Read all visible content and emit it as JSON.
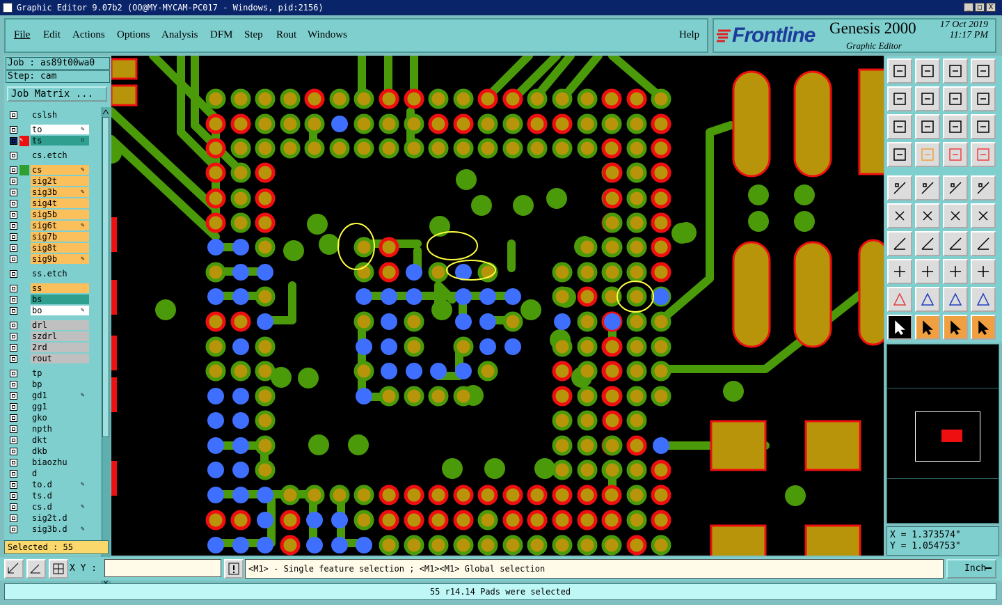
{
  "window": {
    "title": "Graphic Editor 9.07b2 (OO@MY-MYCAM-PC017 - Windows, pid:2156)",
    "controls": [
      "_",
      "□",
      "X"
    ]
  },
  "menu": {
    "items": [
      "File",
      "Edit",
      "Actions",
      "Options",
      "Analysis",
      "DFM",
      "Step",
      "Rout",
      "Windows"
    ],
    "help": "Help"
  },
  "logo": {
    "brand": "Frontline",
    "product": "Genesis 2000",
    "module": "Graphic Editor",
    "date": "17 Oct 2019",
    "time": "11:17 PM"
  },
  "job": {
    "job_line": "Job : as89t00wa0",
    "step_line": "Step: cam",
    "matrix_button": "Job Matrix ..."
  },
  "layers": [
    {
      "name": "cslsh",
      "color": "#7fcfcf"
    },
    {
      "name": "to",
      "color": "#ffffff",
      "mark": "edit"
    },
    {
      "name": "ts",
      "color": "#2f9f8f",
      "mark": "grid",
      "selected": true
    },
    {
      "name": "cs.etch",
      "color": "#7fcfcf"
    },
    {
      "name": "cs",
      "color": "#fbbf5b",
      "mark": "edit",
      "work": true
    },
    {
      "name": "sig2t",
      "color": "#fbbf5b"
    },
    {
      "name": "sig3b",
      "color": "#fbbf5b",
      "mark": "edit"
    },
    {
      "name": "sig4t",
      "color": "#fbbf5b"
    },
    {
      "name": "sig5b",
      "color": "#fbbf5b"
    },
    {
      "name": "sig6t",
      "color": "#fbbf5b",
      "mark": "edit"
    },
    {
      "name": "sig7b",
      "color": "#fbbf5b"
    },
    {
      "name": "sig8t",
      "color": "#fbbf5b"
    },
    {
      "name": "sig9b",
      "color": "#fbbf5b",
      "mark": "edit"
    },
    {
      "name": "ss.etch",
      "color": "#7fcfcf"
    },
    {
      "name": "ss",
      "color": "#fbbf5b"
    },
    {
      "name": "bs",
      "color": "#2f9f8f"
    },
    {
      "name": "bo",
      "color": "#ffffff",
      "mark": "edit"
    },
    {
      "name": "drl",
      "color": "#c0c0c0"
    },
    {
      "name": "szdrl",
      "color": "#c0c0c0"
    },
    {
      "name": "2rd",
      "color": "#c0c0c0"
    },
    {
      "name": "rout",
      "color": "#c0c0c0"
    },
    {
      "name": "tp",
      "color": "#7fcfcf"
    },
    {
      "name": "bp",
      "color": "#7fcfcf"
    },
    {
      "name": "gd1",
      "color": "#7fcfcf",
      "mark": "edit"
    },
    {
      "name": "gg1",
      "color": "#7fcfcf"
    },
    {
      "name": "gko",
      "color": "#7fcfcf"
    },
    {
      "name": "npth",
      "color": "#7fcfcf"
    },
    {
      "name": "dkt",
      "color": "#7fcfcf"
    },
    {
      "name": "dkb",
      "color": "#7fcfcf"
    },
    {
      "name": "biaozhu",
      "color": "#7fcfcf"
    },
    {
      "name": "d",
      "color": "#7fcfcf"
    },
    {
      "name": "to.d",
      "color": "#7fcfcf",
      "mark": "edit"
    },
    {
      "name": "ts.d",
      "color": "#7fcfcf"
    },
    {
      "name": "cs.d",
      "color": "#7fcfcf",
      "mark": "edit"
    },
    {
      "name": "sig2t.d",
      "color": "#7fcfcf"
    },
    {
      "name": "sig3b.d",
      "color": "#7fcfcf",
      "mark": "edit"
    }
  ],
  "selection": {
    "label": "Selected : 55"
  },
  "coordinates": {
    "x": "X = 1.373574\"",
    "y": "Y = 1.054753\""
  },
  "bottom": {
    "xy_label": "X Y :",
    "xy_value": "",
    "hint": "<M1> - Single feature selection ; <M1><M1> Global selection",
    "unit": "Inch"
  },
  "status": "55 r14.14 Pads were selected",
  "colors": {
    "pad_fill": "#b8940a",
    "pad_green_ring": "#4a9a0a",
    "pad_red_ring": "#ee1010",
    "selected_pad": "#3f6fff",
    "trace": "#4a9a0a",
    "highlight": "#ffff40"
  }
}
